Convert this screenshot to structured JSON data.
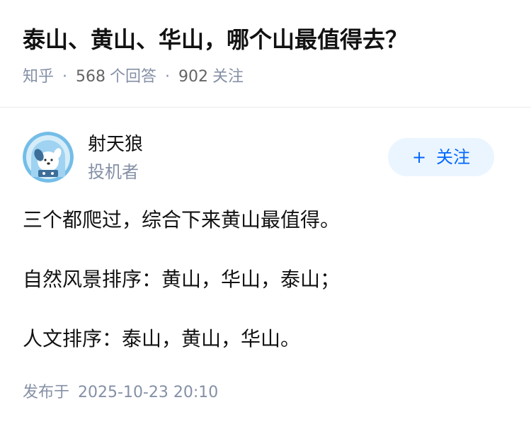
{
  "question": {
    "title": "泰山、黄山、华山，哪个山最值得去？",
    "source": "知乎",
    "separator": "·",
    "answers_count": "568",
    "answers_label": "个回答",
    "followers_count": "902",
    "followers_label": "关注"
  },
  "author": {
    "name": "射天狼",
    "bio": "投机者",
    "avatar_icon": "puppy-avatar-icon"
  },
  "follow_button": {
    "plus": "+",
    "label": "关注"
  },
  "answer": {
    "paragraphs": [
      "三个都爬过，综合下来黄山最值得。",
      "自然风景排序：黄山，华山，泰山；",
      "人文排序：泰山，黄山，华山。"
    ]
  },
  "footer": {
    "publish_label": "发布于",
    "publish_time": "2025-10-23 20:10"
  },
  "colors": {
    "title": "#121212",
    "meta": "#8590a6",
    "accent": "#0066ff",
    "button_bg": "#ebf5ff",
    "avatar_bg": "#74bde8"
  }
}
